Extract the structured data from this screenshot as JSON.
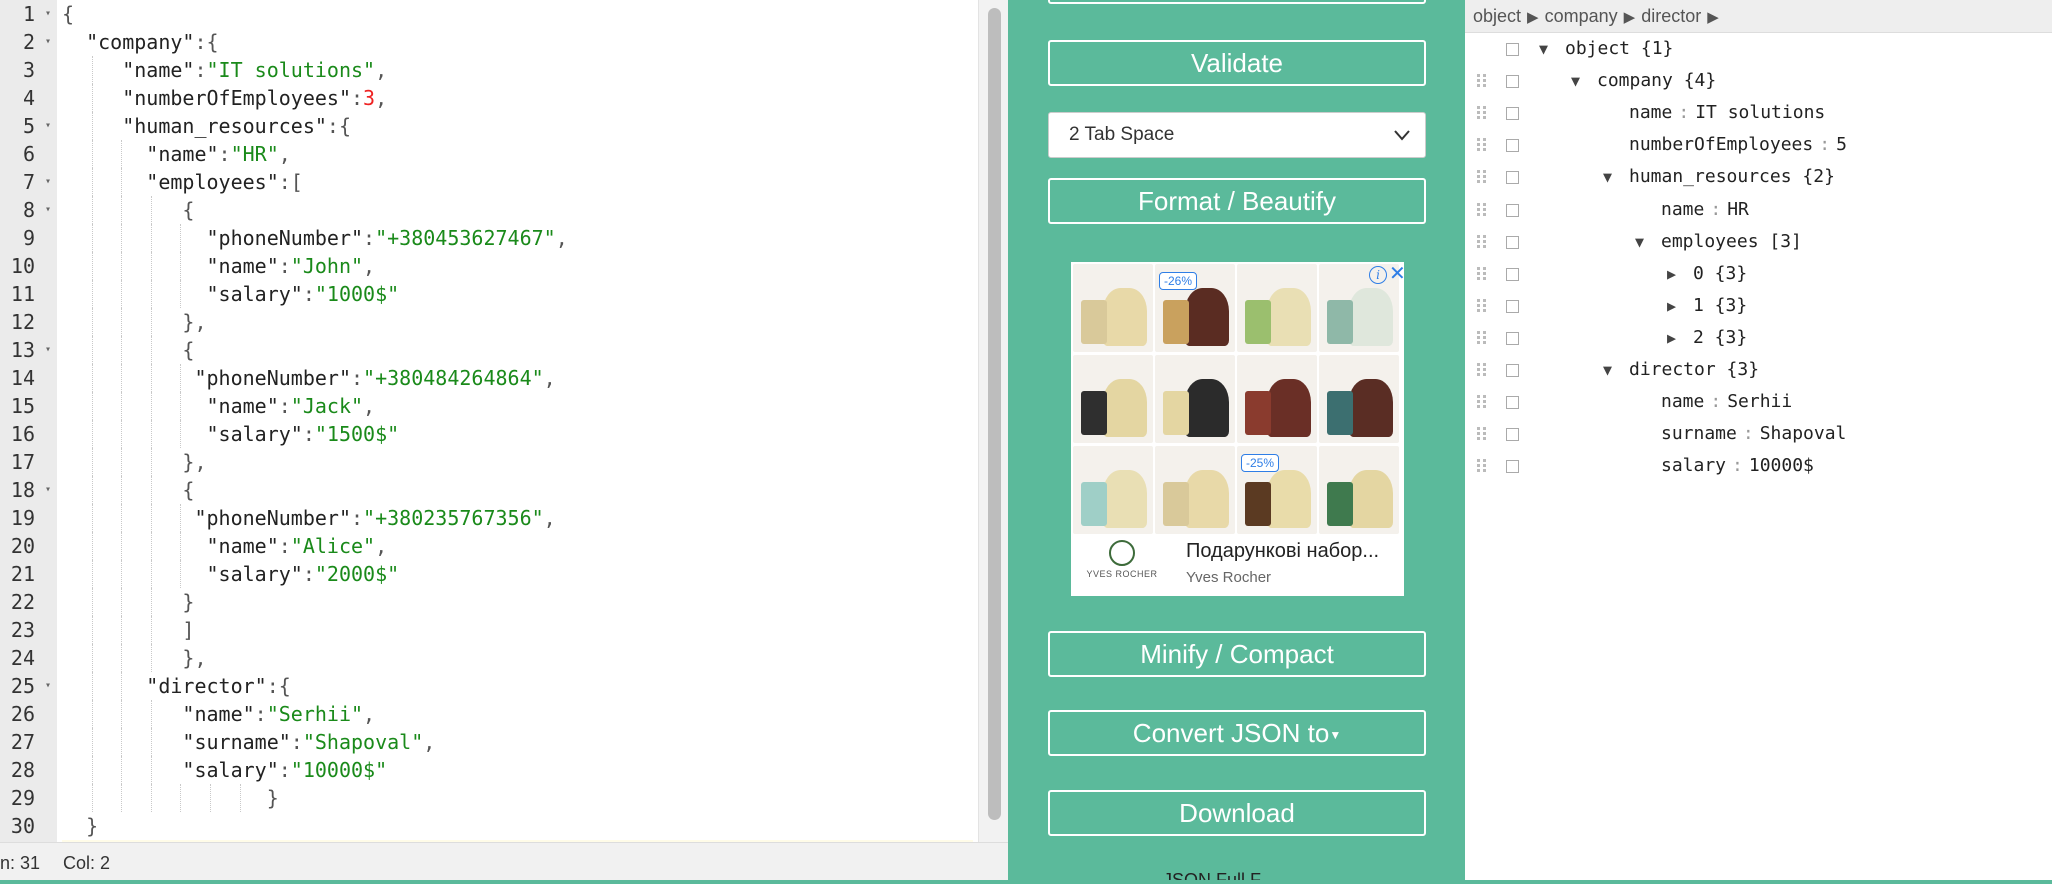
{
  "editor": {
    "lines": [
      [
        [
          "p",
          "{"
        ]
      ],
      [
        [
          "k",
          "  \"company\""
        ],
        [
          "p",
          ":{"
        ]
      ],
      [
        [
          "k",
          "    \"name\""
        ],
        [
          "p",
          ":"
        ],
        [
          "s",
          "\"IT solutions\""
        ],
        [
          "p",
          ","
        ]
      ],
      [
        [
          "k",
          "    \"numberOfEmployees\""
        ],
        [
          "p",
          ":"
        ],
        [
          "n",
          "3"
        ],
        [
          "p",
          ","
        ]
      ],
      [
        [
          "k",
          "    \"human_resources\""
        ],
        [
          "p",
          ":{"
        ]
      ],
      [
        [
          "k",
          "      \"name\""
        ],
        [
          "p",
          ":"
        ],
        [
          "s",
          "\"HR\""
        ],
        [
          "p",
          ","
        ]
      ],
      [
        [
          "k",
          "      \"employees\""
        ],
        [
          "p",
          ":["
        ]
      ],
      [
        [
          "p",
          "        {"
        ]
      ],
      [
        [
          "k",
          "          \"phoneNumber\""
        ],
        [
          "p",
          ":"
        ],
        [
          "s",
          "\"+380453627467\""
        ],
        [
          "p",
          ","
        ]
      ],
      [
        [
          "k",
          "          \"name\""
        ],
        [
          "p",
          ":"
        ],
        [
          "s",
          "\"John\""
        ],
        [
          "p",
          ","
        ]
      ],
      [
        [
          "k",
          "          \"salary\""
        ],
        [
          "p",
          ":"
        ],
        [
          "s",
          "\"1000$\""
        ]
      ],
      [
        [
          "p",
          "        },"
        ]
      ],
      [
        [
          "p",
          "        {"
        ]
      ],
      [
        [
          "k",
          "         \"phoneNumber\""
        ],
        [
          "p",
          ":"
        ],
        [
          "s",
          "\"+380484264864\""
        ],
        [
          "p",
          ","
        ]
      ],
      [
        [
          "k",
          "          \"name\""
        ],
        [
          "p",
          ":"
        ],
        [
          "s",
          "\"Jack\""
        ],
        [
          "p",
          ","
        ]
      ],
      [
        [
          "k",
          "          \"salary\""
        ],
        [
          "p",
          ":"
        ],
        [
          "s",
          "\"1500$\""
        ]
      ],
      [
        [
          "p",
          "        },"
        ]
      ],
      [
        [
          "p",
          "        {"
        ]
      ],
      [
        [
          "k",
          "         \"phoneNumber\""
        ],
        [
          "p",
          ":"
        ],
        [
          "s",
          "\"+380235767356\""
        ],
        [
          "p",
          ","
        ]
      ],
      [
        [
          "k",
          "          \"name\""
        ],
        [
          "p",
          ":"
        ],
        [
          "s",
          "\"Alice\""
        ],
        [
          "p",
          ","
        ]
      ],
      [
        [
          "k",
          "          \"salary\""
        ],
        [
          "p",
          ":"
        ],
        [
          "s",
          "\"2000$\""
        ]
      ],
      [
        [
          "p",
          "        }"
        ]
      ],
      [
        [
          "p",
          "        ]"
        ]
      ],
      [
        [
          "p",
          "        },"
        ]
      ],
      [
        [
          "k",
          "      \"director\""
        ],
        [
          "p",
          ":{"
        ]
      ],
      [
        [
          "k",
          "        \"name\""
        ],
        [
          "p",
          ":"
        ],
        [
          "s",
          "\"Serhii\""
        ],
        [
          "p",
          ","
        ]
      ],
      [
        [
          "k",
          "        \"surname\""
        ],
        [
          "p",
          ":"
        ],
        [
          "s",
          "\"Shapoval\""
        ],
        [
          "p",
          ","
        ]
      ],
      [
        [
          "k",
          "        \"salary\""
        ],
        [
          "p",
          ":"
        ],
        [
          "s",
          "\"10000$\""
        ]
      ],
      [
        [
          "p",
          "              }"
        ]
      ],
      [
        [
          "p",
          "  }"
        ]
      ],
      [
        [
          "p",
          "}"
        ]
      ]
    ],
    "fold_lines": [
      1,
      2,
      5,
      7,
      8,
      13,
      18,
      25
    ],
    "status_ln": "n: 31",
    "status_col": "Col: 2"
  },
  "middle": {
    "validate_label": "Validate",
    "indent_selected": "2 Tab Space",
    "format_label": "Format / Beautify",
    "minify_label": "Minify / Compact",
    "convert_label": "Convert JSON to",
    "download_label": "Download",
    "bottom_cut_text": "JSON Full F",
    "ad": {
      "badge_1": "-26%",
      "badge_2": "-25%",
      "title": "Подарункові набор...",
      "brand": "Yves Rocher",
      "logo_text": "YVES ROCHER"
    }
  },
  "tree": {
    "breadcrumb": [
      "object",
      "company",
      "director"
    ],
    "rows": [
      {
        "indent": 0,
        "toggle": "▼",
        "key": "object",
        "count": "{1}"
      },
      {
        "indent": 1,
        "toggle": "▼",
        "key": "company",
        "count": "{4}"
      },
      {
        "indent": 2,
        "toggle": "",
        "key": "name",
        "value": "IT solutions"
      },
      {
        "indent": 2,
        "toggle": "",
        "key": "numberOfEmployees",
        "value": "5"
      },
      {
        "indent": 2,
        "toggle": "▼",
        "key": "human_resources",
        "count": "{2}"
      },
      {
        "indent": 3,
        "toggle": "",
        "key": "name",
        "value": "HR"
      },
      {
        "indent": 3,
        "toggle": "▼",
        "key": "employees",
        "count": "[3]"
      },
      {
        "indent": 4,
        "toggle": "▶",
        "key": "0",
        "count": "{3}"
      },
      {
        "indent": 4,
        "toggle": "▶",
        "key": "1",
        "count": "{3}"
      },
      {
        "indent": 4,
        "toggle": "▶",
        "key": "2",
        "count": "{3}"
      },
      {
        "indent": 2,
        "toggle": "▼",
        "key": "director",
        "count": "{3}"
      },
      {
        "indent": 3,
        "toggle": "",
        "key": "name",
        "value": "Serhii"
      },
      {
        "indent": 3,
        "toggle": "",
        "key": "surname",
        "value": "Shapoval"
      },
      {
        "indent": 3,
        "toggle": "",
        "key": "salary",
        "value": "10000$"
      }
    ]
  },
  "colors": {
    "accent": "#5bba9b",
    "string": "#1a8a1a",
    "number": "#e22222"
  }
}
